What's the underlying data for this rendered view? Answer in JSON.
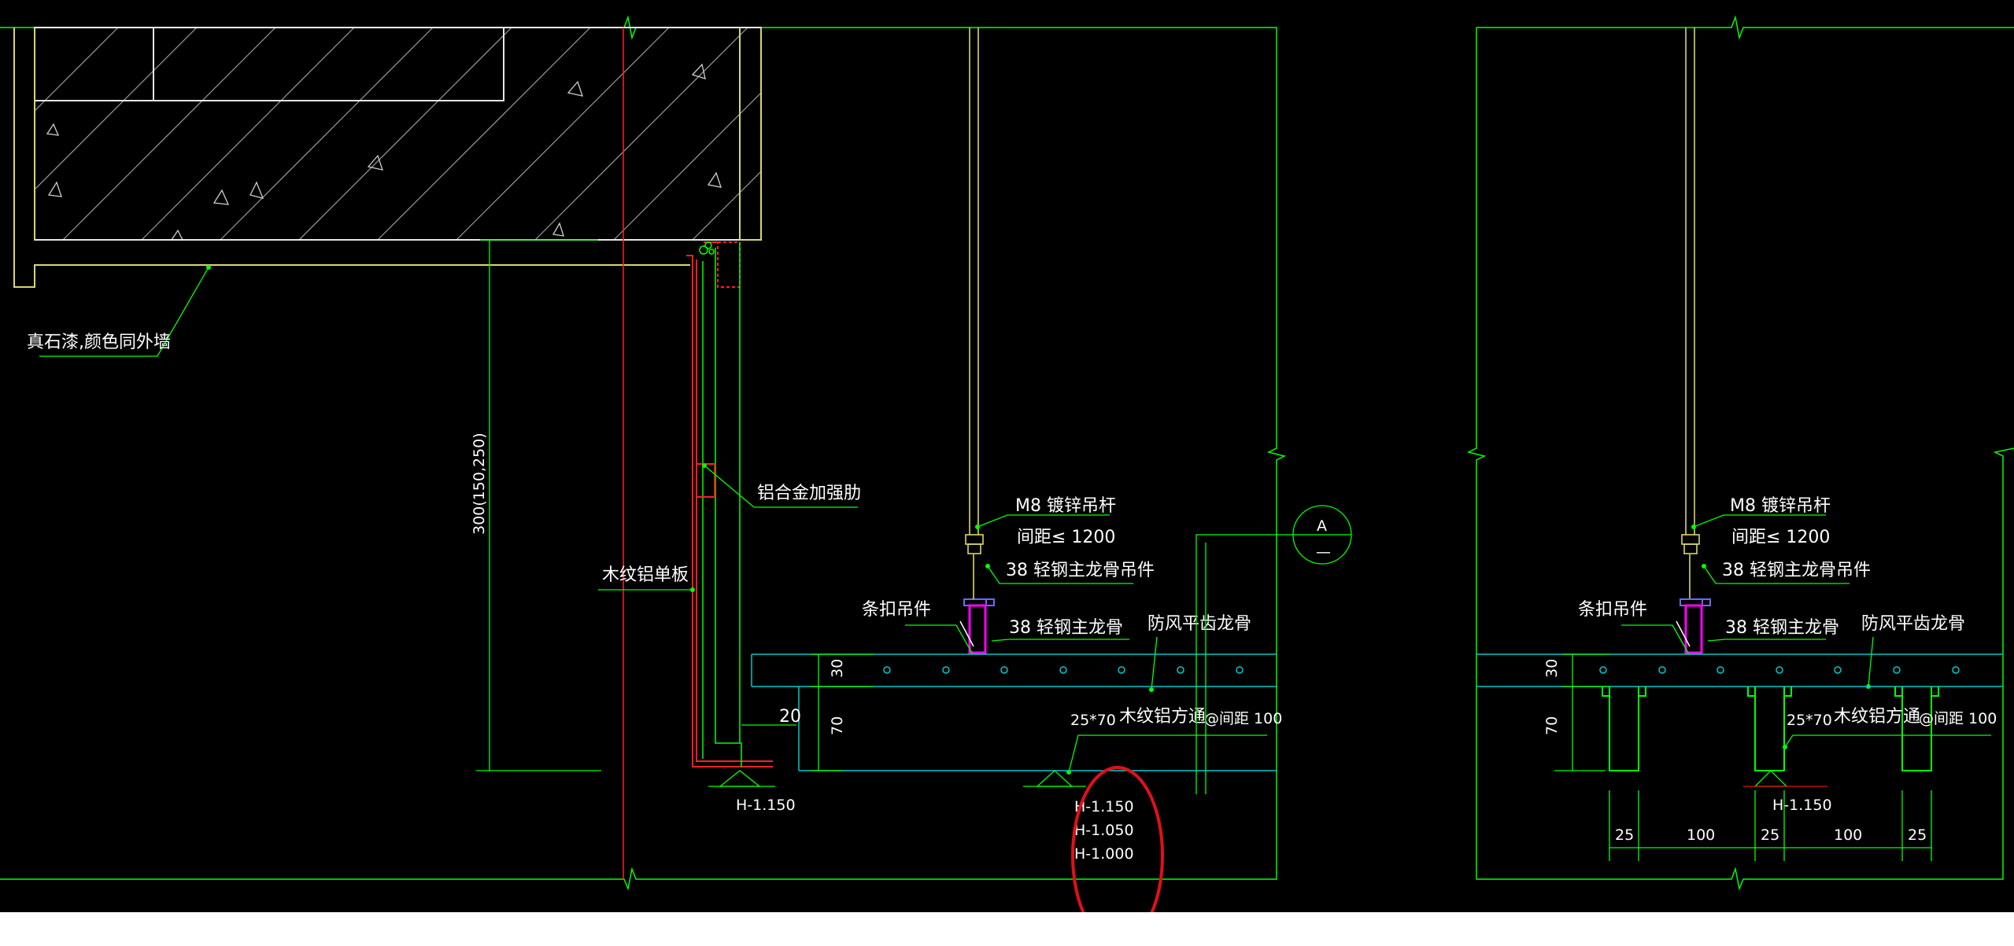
{
  "colors": {
    "background": "#000000",
    "concrete_outline": "#ffffff",
    "structure_yellow": "#d8d86a",
    "line_green": "#00ff00",
    "panel_red": "#ff2020",
    "cyan": "#00c8c8",
    "magenta": "#ff00ff",
    "annotation_red": "#e0101a"
  },
  "left_detail": {
    "label_stone_paint": "真石漆,颜色同外墙",
    "label_wood_panel": "木纹铝单板",
    "label_alu_rib": "铝合金加强肋",
    "label_dim_300": "300(150,250)",
    "label_m8_rod": "M8 镀锌吊杆",
    "label_spacing": "间距≤ 1200",
    "label_38_hanger": "38 轻钢主龙骨吊件",
    "label_clip_hanger": "条扣吊件",
    "label_38_keel": "38 轻钢主龙骨",
    "label_wind_keel": "防风平齿龙骨",
    "label_dim_30": "30",
    "label_dim_70": "70",
    "label_dim_20": "20",
    "label_tube_size": "25*70",
    "label_tube_name": "木纹铝方通",
    "label_tube_spacing": "@间距 100",
    "label_elev_panel": "H-1.150",
    "label_elev_1": "H-1.150",
    "label_elev_2": "H-1.050",
    "label_elev_3": "H-1.000",
    "section_mark_top": "A",
    "section_mark_bottom": "—"
  },
  "right_detail": {
    "label_m8_rod": "M8 镀锌吊杆",
    "label_spacing": "间距≤ 1200",
    "label_38_hanger": "38 轻钢主龙骨吊件",
    "label_clip_hanger": "条扣吊件",
    "label_38_keel": "38 轻钢主龙骨",
    "label_wind_keel": "防风平齿龙骨",
    "label_dim_30": "30",
    "label_dim_70": "70",
    "label_tube_size": "25*70",
    "label_tube_name": "木纹铝方通",
    "label_tube_spacing": "@间距 100",
    "label_elev": "H-1.150",
    "bottom_dims": [
      "25",
      "100",
      "25",
      "100",
      "25"
    ]
  }
}
